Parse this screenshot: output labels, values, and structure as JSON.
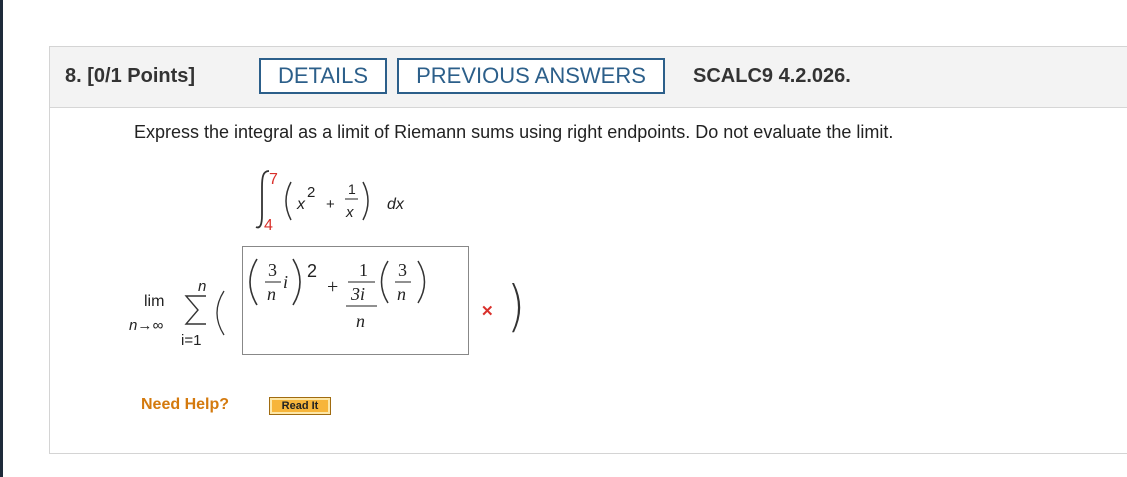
{
  "question": {
    "number_points": "8. [0/1 Points]",
    "details_label": "DETAILS",
    "previous_answers_label": "PREVIOUS ANSWERS",
    "code": "SCALC9 4.2.026."
  },
  "prompt_text": "Express the integral as a limit of Riemann sums using right endpoints. Do not evaluate the limit.",
  "integral": {
    "upper": "7",
    "lower": "4",
    "term1_base": "x",
    "term1_exp": "2",
    "plus": "+",
    "frac_num": "1",
    "frac_den": "x",
    "dx": "dx"
  },
  "limit": {
    "lim": "lim",
    "sub": "n→∞",
    "sum_upper": "n",
    "sum_lower": "i=1"
  },
  "answer": {
    "frac1_num": "3",
    "frac1_den": "n",
    "frac1_var": "i",
    "exp": "2",
    "plus": "+",
    "frac2_num": "1",
    "frac2_den_inner": "3i",
    "frac2_den_outer": "n",
    "frac3_num": "3",
    "frac3_den": "n",
    "status": "incorrect",
    "status_mark": "✕",
    "status_color": "#d9302b"
  },
  "help": {
    "need_help": "Need Help?",
    "read_it": "Read It"
  },
  "colors": {
    "accent": "#2c5f8a",
    "limit_red": "#d9302b",
    "help_orange": "#d47a0e",
    "button_gold": "#f7b53a"
  }
}
